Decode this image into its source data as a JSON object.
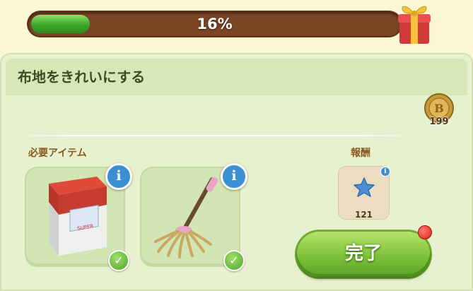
{
  "progress": {
    "label": "16%",
    "value": 0.16
  },
  "task": {
    "title": "布地をきれいにする"
  },
  "coin_reward": {
    "count": "199",
    "coin_letter": "B"
  },
  "required_items": {
    "label": "必要アイテム",
    "items": [
      {
        "name": "detergent-box",
        "info_label": "i",
        "check": "✓"
      },
      {
        "name": "mop",
        "info_label": "i",
        "check": "✓"
      }
    ]
  },
  "reward": {
    "label": "報酬",
    "count": "121",
    "info_label": "i"
  },
  "complete_button": {
    "label": "完了"
  },
  "colors": {
    "accent_green": "#7fc23a",
    "bar_brown": "#7a4425",
    "info_blue": "#3b8fd3"
  }
}
